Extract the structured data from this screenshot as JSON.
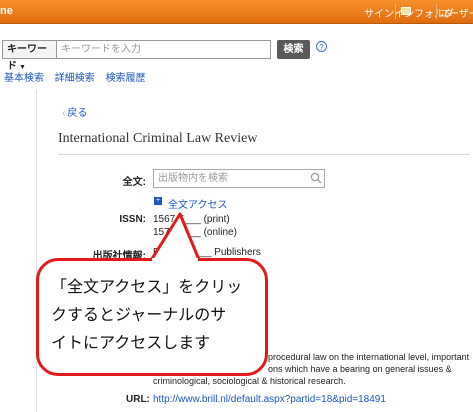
{
  "topbar": {
    "brand": "ne",
    "signin": "サインイン",
    "folder": "フォルダ",
    "user": "ユーザー設"
  },
  "search": {
    "field": "キーワード",
    "placeholder": "キーワードを入力",
    "button": "検索",
    "help": "?"
  },
  "sublinks": [
    "基本検索",
    "詳細検索",
    "検索履歴"
  ],
  "back": "戻る",
  "journal": {
    "title": "International Criminal Law Review",
    "fulltext_label": "全文:",
    "fulltext_placeholder": "出版物内を検索",
    "fulltext_link": "全文アクセス",
    "issn_label": "ISSN:",
    "issn_print": "1567-5___ (print)",
    "issn_online": "1571-____ (online)",
    "publisher_label": "出版社情報:",
    "publisher": "Brill _______ Publishers",
    "desc_line1": "procedural law on the international level, important",
    "desc_line2": "ons which have a bearing on general issues &",
    "desc_line3": "criminological, sociological & historical research.",
    "url_label": "URL:",
    "url": "http://www.brill.nl/default.aspx?partid=18&pid=18491"
  },
  "callout": {
    "line1": "「全文アクセス」をクリッ",
    "line2": "クするとジャーナルのサ",
    "line3": "イトにアクセスします"
  },
  "colors": {
    "topbar": "#f08020",
    "callout_border": "#e21a1a",
    "link": "#1a56c4"
  }
}
